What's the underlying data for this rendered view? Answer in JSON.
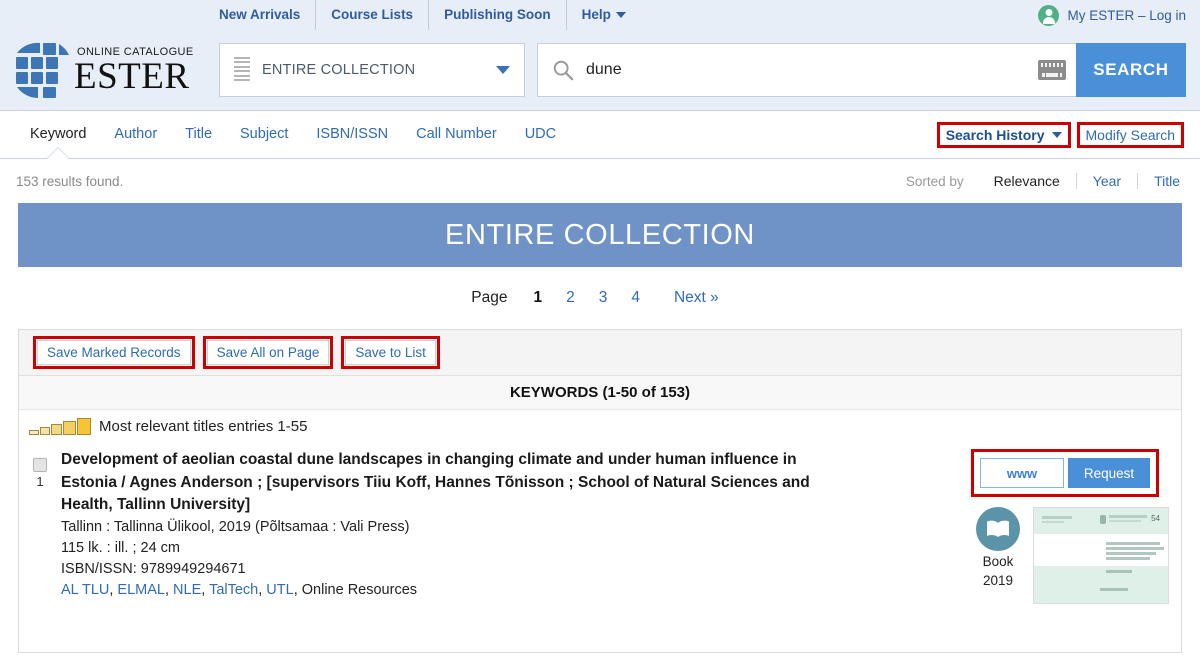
{
  "topbar": {
    "links": [
      {
        "label": "New Arrivals",
        "has_caret": false
      },
      {
        "label": "Course Lists",
        "has_caret": false
      },
      {
        "label": "Publishing Soon",
        "has_caret": false
      },
      {
        "label": "Help",
        "has_caret": true
      }
    ],
    "account": {
      "label": "My ESTER – Log in",
      "avatar_icon": "user-avatar-icon",
      "avatar_color": "#4fb286"
    }
  },
  "header": {
    "logo": {
      "subtitle": "ONLINE CATALOGUE",
      "title": "ESTER",
      "mark_icon": "ester-grid-logo-icon",
      "mark_color": "#3d75b5"
    },
    "scope": {
      "value": "ENTIRE COLLECTION",
      "menu_icon": "hamburger-icon",
      "caret_icon": "chevron-down-icon"
    },
    "search": {
      "value": "dune",
      "placeholder": "",
      "search_icon": "magnifier-icon",
      "keyboard_icon": "virtual-keyboard-icon",
      "button_label": "SEARCH",
      "button_color": "#4a90d9"
    }
  },
  "tabs": {
    "items": [
      {
        "label": "Keyword",
        "active": true
      },
      {
        "label": "Author",
        "active": false
      },
      {
        "label": "Title",
        "active": false
      },
      {
        "label": "Subject",
        "active": false
      },
      {
        "label": "ISBN/ISSN",
        "active": false
      },
      {
        "label": "Call Number",
        "active": false
      },
      {
        "label": "UDC",
        "active": false
      }
    ],
    "search_history": {
      "label": "Search History",
      "caret_icon": "chevron-down-icon",
      "annotated": true
    },
    "modify_search": {
      "label": "Modify Search",
      "annotated": true
    }
  },
  "info": {
    "results_found": "153 results found.",
    "sorted_by_label": "Sorted by",
    "sort_options": [
      {
        "label": "Relevance",
        "active": true
      },
      {
        "label": "Year",
        "active": false
      },
      {
        "label": "Title",
        "active": false
      }
    ]
  },
  "banner": {
    "title": "ENTIRE COLLECTION",
    "color": "#6f93c7"
  },
  "pagination": {
    "label": "Page",
    "pages": [
      {
        "label": "1",
        "current": true
      },
      {
        "label": "2",
        "current": false
      },
      {
        "label": "3",
        "current": false
      },
      {
        "label": "4",
        "current": false
      }
    ],
    "next_label": "Next »"
  },
  "results": {
    "save_buttons": [
      {
        "label": "Save Marked Records",
        "annotated": true
      },
      {
        "label": "Save All on Page",
        "annotated": true
      },
      {
        "label": "Save to List",
        "annotated": true
      }
    ],
    "keywords_header": "KEYWORDS (1-50 of 153)",
    "relevance": {
      "text": "Most relevant titles entries 1-55",
      "bars_icon": "relevance-bars-icon",
      "bar_count": 5,
      "bar_colors": [
        "#f6e9c2",
        "#f5e2a8",
        "#f5d887",
        "#f6cf5f",
        "#f7c433"
      ]
    },
    "records": [
      {
        "number": "1",
        "checkbox_checked": false,
        "title": "Development of aeolian coastal dune landscapes in changing climate and under human influence in Estonia / Agnes Anderson ; [supervisors Tiiu Koff, Hannes Tõnisson ; School of Natural Sciences and Health, Tallinn University]",
        "imprint": "Tallinn : Tallinna Ülikool, 2019 (Põltsamaa : Vali Press)",
        "extent": "115 lk. : ill. ; 24 cm",
        "isbn": "ISBN/ISSN:  9789949294671",
        "holdings_links": [
          "AL TLU",
          "ELMAL",
          "NLE",
          "TalTech",
          "UTL"
        ],
        "holdings_tail": ", Online Resources",
        "actions": {
          "www_label": "www",
          "request_label": "Request",
          "annotated": true
        },
        "media": {
          "type_icon": "open-book-icon",
          "type_label": "Book",
          "year_label": "2019",
          "thumbnail_alt": "book-cover-thumbnail"
        }
      }
    ]
  },
  "colors": {
    "accent_blue": "#4a90d9",
    "link_blue": "#2f6cb5",
    "banner_blue": "#6f93c7",
    "annotation_red": "#cc0000",
    "header_bg": "#e8eef7"
  }
}
